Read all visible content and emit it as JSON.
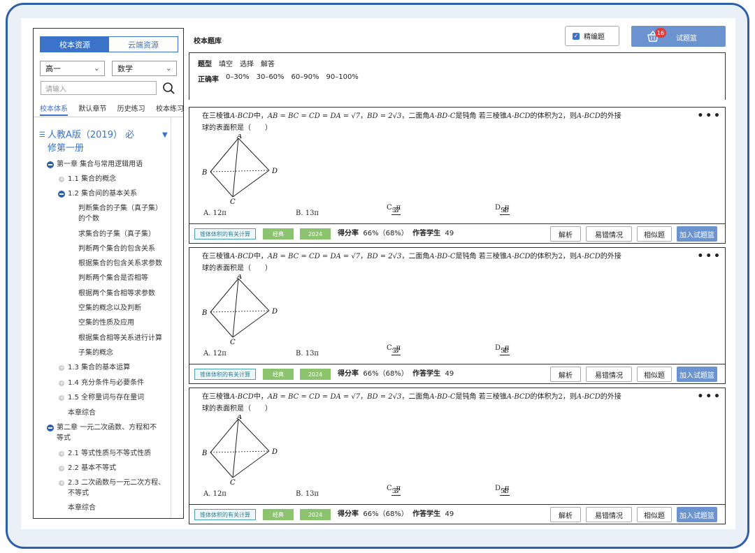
{
  "sidebar": {
    "source_tabs": [
      "校本资源",
      "云端资源"
    ],
    "grade": "高一",
    "subject": "数学",
    "search_placeholder": "请输入",
    "subtabs": [
      "校本体系",
      "默认章节",
      "历史练习",
      "校本练习"
    ],
    "book_line1": "人教A版（2019） 必",
    "book_line2": "修第一册",
    "tree": [
      {
        "label": "第一章 集合与常用逻辑用语",
        "level": 0,
        "state": "open"
      },
      {
        "label": "1.1 集合的概念",
        "level": 1,
        "state": "closed"
      },
      {
        "label": "1.2 集合间的基本关系",
        "level": 1,
        "state": "open"
      },
      {
        "label": "判断集合的子集（真子集）",
        "level": 2
      },
      {
        "label": "的个数",
        "level": 2
      },
      {
        "label": "求集合的子集（真子集）",
        "level": 2
      },
      {
        "label": "判断两个集合的包含关系",
        "level": 2
      },
      {
        "label": "根据集合的包含关系求参数",
        "level": 2
      },
      {
        "label": "判断两个集合是否相等",
        "level": 2
      },
      {
        "label": "根据两个集合相等求参数",
        "level": 2
      },
      {
        "label": "空集的概念以及判断",
        "level": 2
      },
      {
        "label": "空集的性质及应用",
        "level": 2
      },
      {
        "label": "根据集合相等关系进行计算",
        "level": 2
      },
      {
        "label": "子集的概念",
        "level": 2
      },
      {
        "label": "1.3 集合的基本运算",
        "level": 1,
        "state": "closed"
      },
      {
        "label": "1.4 充分条件与必要条件",
        "level": 1,
        "state": "closed"
      },
      {
        "label": "1.5 全称量词与存在量词",
        "level": 1,
        "state": "closed"
      },
      {
        "label": "本章综合",
        "level": 1
      },
      {
        "label": "第二章 一元二次函数、方程和不",
        "level": 0,
        "state": "open"
      },
      {
        "label": "等式",
        "level": 0
      },
      {
        "label": "2.1 等式性质与不等式性质",
        "level": 1,
        "state": "closed"
      },
      {
        "label": "2.2 基本不等式",
        "level": 1,
        "state": "closed"
      },
      {
        "label": "2.3 二次函数与一元二次方程、",
        "level": 1,
        "state": "closed"
      },
      {
        "label": "不等式",
        "level": 1
      },
      {
        "label": "本章综合",
        "level": 1
      }
    ]
  },
  "header": {
    "title": "校本题库",
    "checkbox_label": "精编题",
    "basket_label": "试题篮",
    "basket_count": "16"
  },
  "filter": {
    "type_label": "题型",
    "types": [
      "填空",
      "选择",
      "解答"
    ],
    "rate_label": "正确率",
    "rates": [
      "0–30%",
      "30–60%",
      "60–90%",
      "90–100%"
    ]
  },
  "question": {
    "line1_a": "在三棱锥",
    "line1_b": "A-BCD",
    "line1_c": "中，",
    "line1_d": "AB = BC = CD = DA = √7",
    "line1_e": "，",
    "line1_f": "BD = 2√3",
    "line1_g": "，二面角",
    "line1_h": "A-BD-C",
    "line1_i": "是钝角 若三棱锥",
    "line1_j": "A-BCD",
    "line1_k": "的体积为2，则",
    "line1_l": "A-BCD",
    "line1_m": "的外接",
    "line2": "球的表面积是（　　）",
    "opt_a": "A. 12π",
    "opt_b": "B. 13π",
    "opt_c_pre": "C. ",
    "opt_c_num": "37",
    "opt_c_den": "3",
    "opt_c_post": "π",
    "opt_d_pre": "D. ",
    "opt_d_num": "53",
    "opt_d_den": "4",
    "opt_d_post": "π",
    "fig_labels": {
      "a": "A",
      "b": "B",
      "c": "C",
      "d": "D"
    }
  },
  "meta": {
    "knowledge_tag": "锥体体积的有关计算",
    "class_tag": "经典",
    "year_tag": "2024",
    "score_label": "得分率",
    "score_value": "66%（68%）",
    "students_label": "作答学生",
    "students_value": "49"
  },
  "actions": {
    "analysis": "解析",
    "errors": "易错情况",
    "similar": "相似题",
    "add": "加入试题篮"
  }
}
